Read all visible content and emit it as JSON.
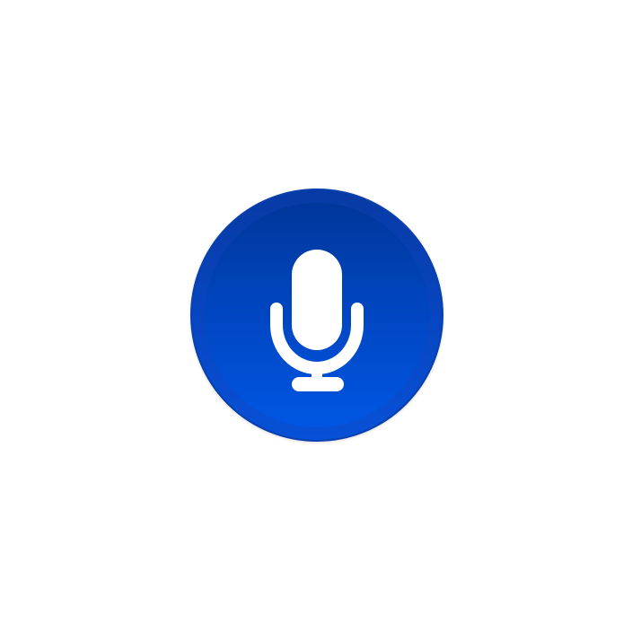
{
  "button": {
    "icon": "microphone-icon",
    "colors": {
      "gradient_top": "#003596",
      "gradient_bottom": "#0058e6",
      "border": "#0a3fae",
      "icon": "#ffffff"
    }
  }
}
